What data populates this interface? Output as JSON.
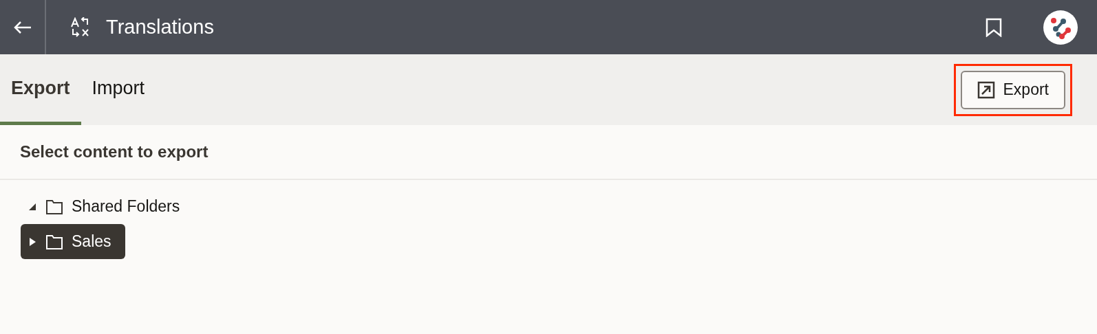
{
  "header": {
    "title": "Translations"
  },
  "tabs": [
    {
      "label": "Export",
      "selected": true
    },
    {
      "label": "Import",
      "selected": false
    }
  ],
  "toolbar": {
    "export_button": {
      "label": "Export",
      "highlighted": true
    }
  },
  "section_title": "Select content to export",
  "tree": [
    {
      "label": "Shared Folders",
      "expanded": true,
      "selected": false,
      "children": [
        {
          "label": "Sales",
          "expanded": false,
          "selected": true
        }
      ]
    }
  ]
}
